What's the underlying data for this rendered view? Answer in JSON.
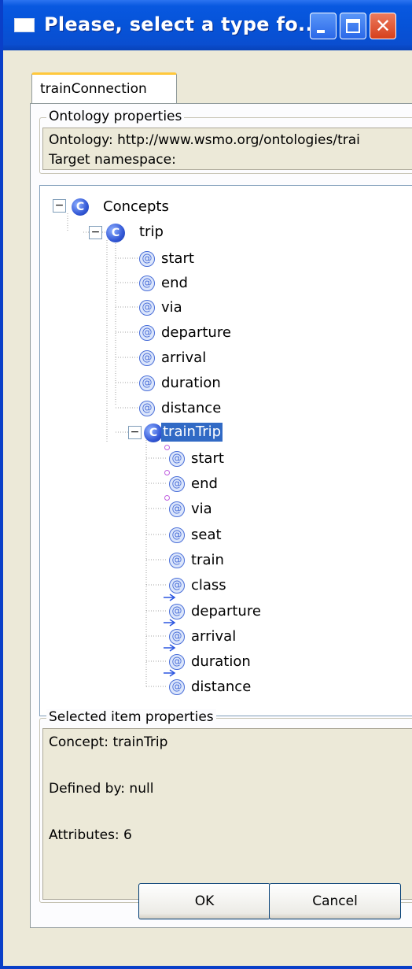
{
  "window": {
    "title": "Please, select a type fo...",
    "close_glyph": "✕"
  },
  "tabs": [
    {
      "label": "trainConnection"
    }
  ],
  "ontology_properties": {
    "title": "Ontology properties",
    "ontology": "Ontology: http://www.wsmo.org/ontologies/trai",
    "namespace": "Target namespace:"
  },
  "tree": {
    "root": "Concepts",
    "trip": {
      "label": "trip",
      "attributes": [
        "start",
        "end",
        "via",
        "departure",
        "arrival",
        "duration",
        "distance"
      ]
    },
    "trainTrip": {
      "label": "trainTrip",
      "attributes": [
        {
          "label": "start",
          "marker": "dot"
        },
        {
          "label": "end",
          "marker": "dot"
        },
        {
          "label": "via",
          "marker": "dot"
        },
        {
          "label": "seat",
          "marker": "none"
        },
        {
          "label": "train",
          "marker": "none"
        },
        {
          "label": "class",
          "marker": "none"
        },
        {
          "label": "departure",
          "marker": "arrow"
        },
        {
          "label": "arrival",
          "marker": "arrow"
        },
        {
          "label": "duration",
          "marker": "arrow"
        },
        {
          "label": "distance",
          "marker": "arrow"
        }
      ]
    },
    "icon_letters": {
      "concept": "C",
      "attribute": "@"
    }
  },
  "selected_item_properties": {
    "title": "Selected item properties",
    "concept": "Concept: trainTrip",
    "defined_by": "Defined by: null",
    "attributes": "Attributes: 6"
  },
  "buttons": {
    "ok": "OK",
    "cancel": "Cancel"
  },
  "colors": {
    "titlebar": "#0653d8",
    "selection": "#316ac5",
    "concept_icon": "#3358d6",
    "attribute_icon": "#4a6fd8",
    "inherited_marker": "#c060e0",
    "arrow_marker": "#2a55e0"
  }
}
